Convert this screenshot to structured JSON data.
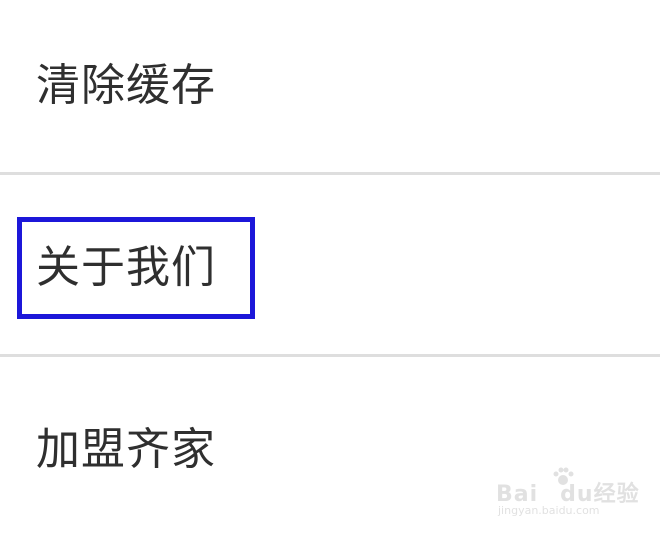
{
  "menu": {
    "items": [
      {
        "label": "清除缓存"
      },
      {
        "label": "关于我们",
        "highlighted": true
      },
      {
        "label": "加盟齐家"
      }
    ]
  },
  "highlight": {
    "color": "#1c17d9"
  },
  "watermark": {
    "brand": "Bai",
    "brand_suffix": "du",
    "service": "经验",
    "domain": "jingyan.baidu.com"
  }
}
